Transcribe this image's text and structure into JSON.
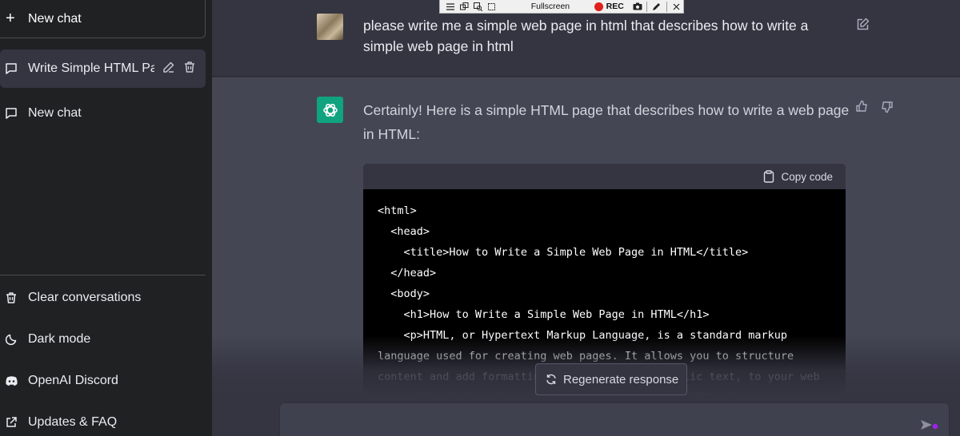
{
  "sidebar": {
    "new_chat_label": "New chat",
    "conversations": [
      {
        "label": "Write Simple HTML Page",
        "active": true
      },
      {
        "label": "New chat",
        "active": false
      }
    ],
    "bottom_items": [
      {
        "label": "Clear conversations",
        "icon": "trash-icon"
      },
      {
        "label": "Dark mode",
        "icon": "moon-icon"
      },
      {
        "label": "OpenAI Discord",
        "icon": "discord-icon"
      },
      {
        "label": "Updates & FAQ",
        "icon": "external-link-icon"
      }
    ]
  },
  "chat": {
    "user_message": "please write me a simple web page in html that describes how to write a simple web page in html",
    "assistant_message": "Certainly! Here is a simple HTML page that describes how to write a web page in HTML:",
    "code_block": {
      "copy_label": "Copy code",
      "code": "<html>\n  <head>\n    <title>How to Write a Simple Web Page in HTML</title>\n  </head>\n  <body>\n    <h1>How to Write a Simple Web Page in HTML</h1>\n    <p>HTML, or Hypertext Markup Language, is a standard markup language used for creating web pages. It allows you to structure content and add formatting, such as bold or italic text, to your web pages. Here's how to write a simple web page in HTML:</p>"
    }
  },
  "regenerate_label": "Regenerate response",
  "input": {
    "placeholder": ""
  },
  "recorder_toolbar": {
    "fullscreen_label": "Fullscreen",
    "rec_label": "REC"
  },
  "colors": {
    "sidebar_bg": "#202123",
    "main_bg": "#343541",
    "assistant_bg": "#444654",
    "brand_green": "#10a37f",
    "rec_red": "#e0201c"
  }
}
